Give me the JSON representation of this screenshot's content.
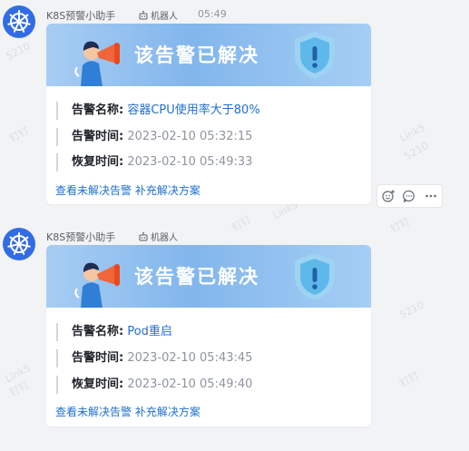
{
  "watermark": {
    "text1": "Link5",
    "text2": "5210",
    "text3": "钉钉"
  },
  "messages": [
    {
      "sender": "K8S预警小助手",
      "bot_tag": "机器人",
      "time": "05:49",
      "banner_title": "该告警已解决",
      "rows": [
        {
          "label": "告警名称:",
          "value": "容器CPU使用率大于80%"
        },
        {
          "label": "告警时间:",
          "value": "2023-02-10 05:32:15"
        },
        {
          "label": "恢复时间:",
          "value": "2023-02-10 05:49:33"
        }
      ],
      "links": {
        "view": "查看未解决告警",
        "add": "补充解决方案"
      }
    },
    {
      "sender": "K8S预警小助手",
      "bot_tag": "机器人",
      "banner_title": "该告警已解决",
      "rows": [
        {
          "label": "告警名称:",
          "value": "Pod重启"
        },
        {
          "label": "告警时间:",
          "value": "2023-02-10 05:43:45"
        },
        {
          "label": "恢复时间:",
          "value": "2023-02-10 05:49:40"
        }
      ],
      "links": {
        "view": "查看未解决告警",
        "add": "补充解决方案"
      }
    }
  ],
  "icons": {
    "avatar": "kubernetes-icon",
    "bot": "robot-icon",
    "figure": "megaphone-person-icon",
    "shield": "shield-alert-icon",
    "actions": [
      "emoji-icon",
      "comment-icon",
      "more-icon"
    ]
  },
  "colors": {
    "accent": "#1f6fd1",
    "avatar": "#326ce5",
    "banner": "#82b6ec"
  }
}
